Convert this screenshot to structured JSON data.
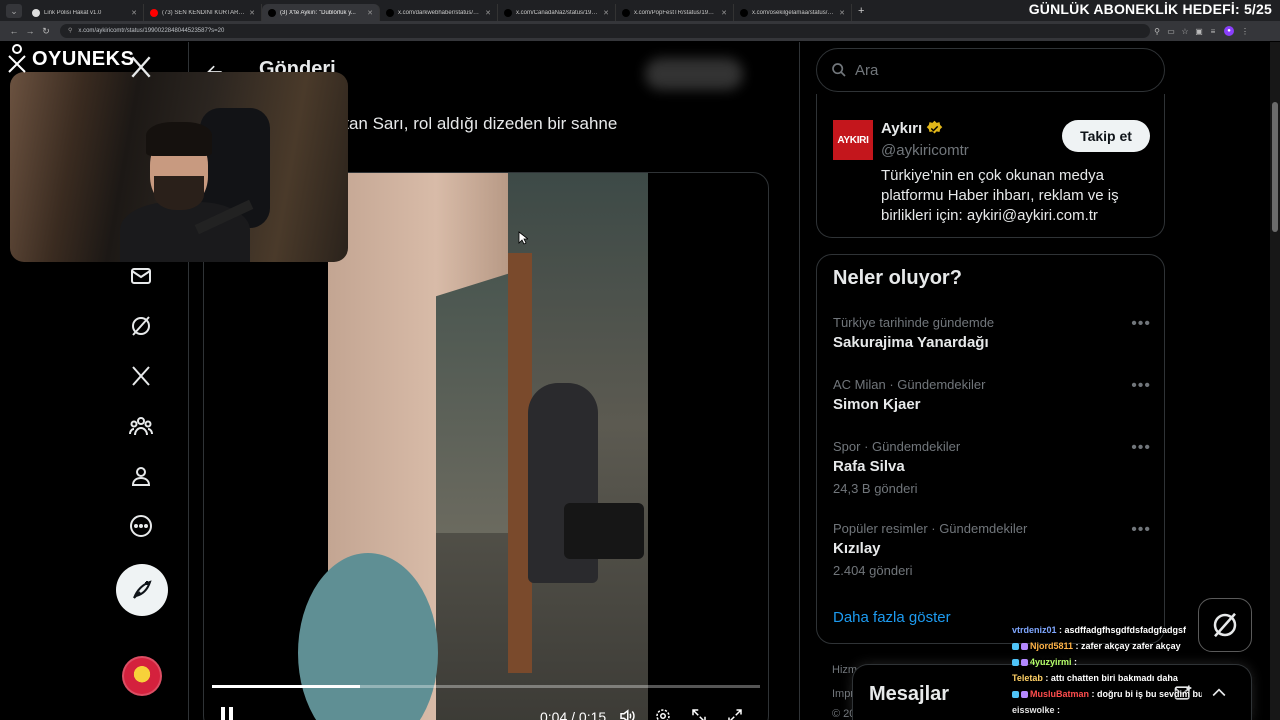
{
  "browser": {
    "tabs": [
      {
        "label": "Link Polisi Hakat v1.0",
        "favicon": "github-icon",
        "active": false
      },
      {
        "label": "(73) SEN KENDİNİ KURTAR | 5...",
        "favicon": "youtube-icon",
        "active": false
      },
      {
        "label": "(3) X'te Aykırı: \"Dublörlük y...",
        "favicon": "x-icon",
        "active": true
      },
      {
        "label": "x.com/darkwebhaber/status/19...",
        "favicon": "x-icon",
        "active": false
      },
      {
        "label": "x.com/CanadaNaz/status/1989...",
        "favicon": "x-icon",
        "active": false
      },
      {
        "label": "x.com/PopFestTR/status/19893...",
        "favicon": "x-icon",
        "active": false
      },
      {
        "label": "x.com/osekilgelamaa/status/19...",
        "favicon": "x-icon",
        "active": false
      }
    ],
    "url": "x.com/aykiricomtr/status/1990022848044523587?s=20"
  },
  "overlay": {
    "goal": "GÜNLÜK ABONEKLİK HEDEFİ: 5/25",
    "brand": "OYUNEKS"
  },
  "main": {
    "title": "Gönderi",
    "tweet_text": "...yuncu Yavuz Sultan Sarı, rol aldığı dizeden bir sahne",
    "video": {
      "current_time": "0:04",
      "duration": "0:15",
      "time_display": "0:04 / 0:15",
      "progress_fraction": 0.27
    }
  },
  "right": {
    "search_placeholder": "Ara",
    "profile": {
      "logo_text": "AYKIRI",
      "name": "Aykırı",
      "handle": "@aykiricomtr",
      "follow_label": "Takip et",
      "bio": "Türkiye'nin en çok okunan medya platformu Haber ihbarı, reklam ve iş birlikleri için: aykiri@aykiri.com.tr"
    },
    "trends_title": "Neler oluyor?",
    "trends": [
      {
        "meta": "Türkiye tarihinde gündemde",
        "name": "Sakurajima Yanardağı",
        "count": ""
      },
      {
        "meta": "AC Milan · Gündemdekiler",
        "name": "Simon Kjaer",
        "count": ""
      },
      {
        "meta": "Spor · Gündemdekiler",
        "name": "Rafa Silva",
        "count": "24,3 B gönderi"
      },
      {
        "meta": "Popüler resimler · Gündemdekiler",
        "name": "Kızılay",
        "count": "2.404 gönderi"
      }
    ],
    "show_more": "Daha fazla göster",
    "footer": [
      "Hizm",
      "Impr",
      "© 20"
    ],
    "messages_title": "Mesajlar"
  },
  "chat": [
    {
      "user": "vtrdeniz01",
      "color": "#7fa7ff",
      "message": "asdffadgfhsgdfdsfadgfadgsf",
      "badges": 0
    },
    {
      "user": "Njord5811",
      "color": "#ffb347",
      "message": "zafer akçay zafer akçay",
      "badges": 2
    },
    {
      "user": "4yuzyirmi",
      "color": "#b6ff6b",
      "message": "",
      "badges": 2
    },
    {
      "user": "Teletab",
      "color": "#ffd166",
      "message": "attı chatten biri bakmadı daha",
      "badges": 0
    },
    {
      "user": "MusluBatman",
      "color": "#ff4d4d",
      "message": "doğru bi iş bu sevdim bunu",
      "badges": 2
    },
    {
      "user": "eisswolke",
      "color": "#e0e0e0",
      "message": "",
      "badges": 0
    }
  ]
}
